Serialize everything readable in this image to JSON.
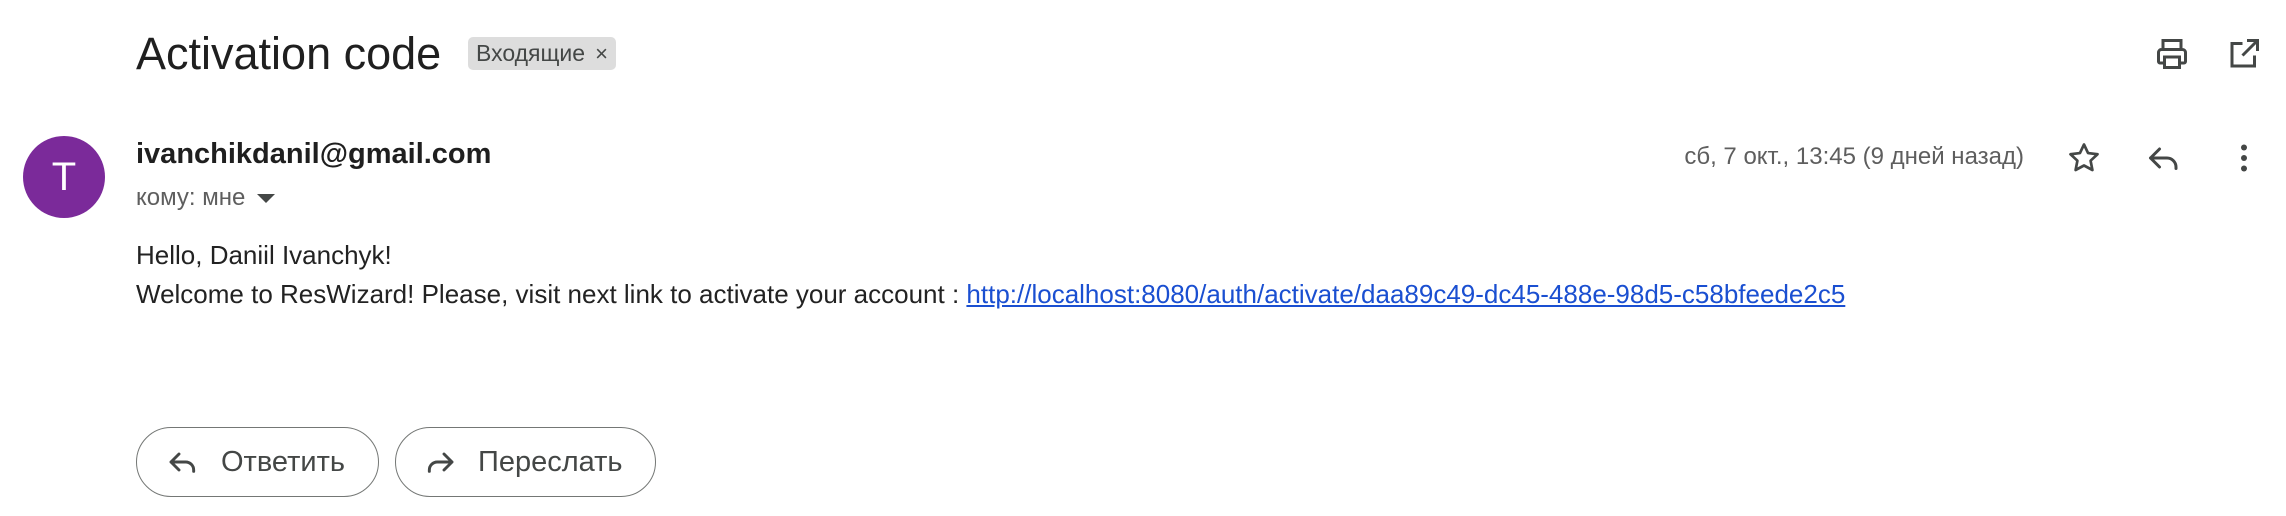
{
  "email": {
    "subject": "Activation code",
    "label_chip": "Входящие",
    "label_remove_glyph": "×",
    "sender_initial": "T",
    "sender": "ivanchikdanil@gmail.com",
    "recipient_line": "кому: мне",
    "date": "сб, 7 окт., 13:45 (9 дней назад)",
    "body": {
      "greeting": "Hello, Daniil Ivanchyk!",
      "line_prefix": "Welcome to ResWizard! Please, visit next link to activate your account : ",
      "link": "http://localhost:8080/auth/activate/daa89c49-dc45-488e-98d5-c58bfeede2c5"
    }
  },
  "actions": {
    "reply_label": "Ответить",
    "forward_label": "Переслать"
  },
  "icons": {
    "top_right": [
      "print-icon",
      "open-in-new-window-icon"
    ],
    "message_actions": [
      "star-icon",
      "reply-icon",
      "more-vertical-icon"
    ]
  },
  "colors": {
    "avatar_bg": "#7b2a9a",
    "link": "#1a4fd1",
    "chip_bg": "#dddddd"
  }
}
